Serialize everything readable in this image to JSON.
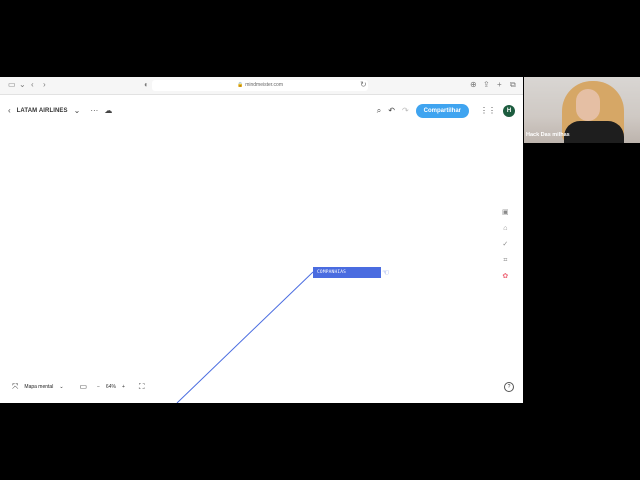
{
  "browser": {
    "url": "mindmeister.com"
  },
  "app": {
    "doc_title": "LATAM AIRLINES",
    "share_label": "Compartilhar",
    "user_initial": "H",
    "colors": {
      "accent": "#3fa4f0",
      "node": "#4a6ce0",
      "avatar": "#1d5c3f"
    }
  },
  "canvas": {
    "node_label": "COMPANHIAS PARCEIRAS",
    "node_close": "×"
  },
  "bottom": {
    "view_mode": "Mapa mental",
    "zoom": "64%",
    "zoom_minus": "−",
    "zoom_plus": "+"
  },
  "video": {
    "participant_name": "Hack Das milhas"
  },
  "icons": {
    "sidebar": "sidebar-icon",
    "back": "chevron-left-icon",
    "forward": "chevron-right-icon",
    "shield": "shield-icon",
    "reload": "reload-icon",
    "download": "download-icon",
    "share": "share-icon",
    "new_tab": "plus-icon",
    "tabs": "tabs-icon",
    "more": "more-icon",
    "cloud": "cloud-icon",
    "search": "search-icon",
    "undo": "undo-icon",
    "redo": "redo-icon",
    "apps": "apps-icon",
    "help": "help-icon"
  }
}
